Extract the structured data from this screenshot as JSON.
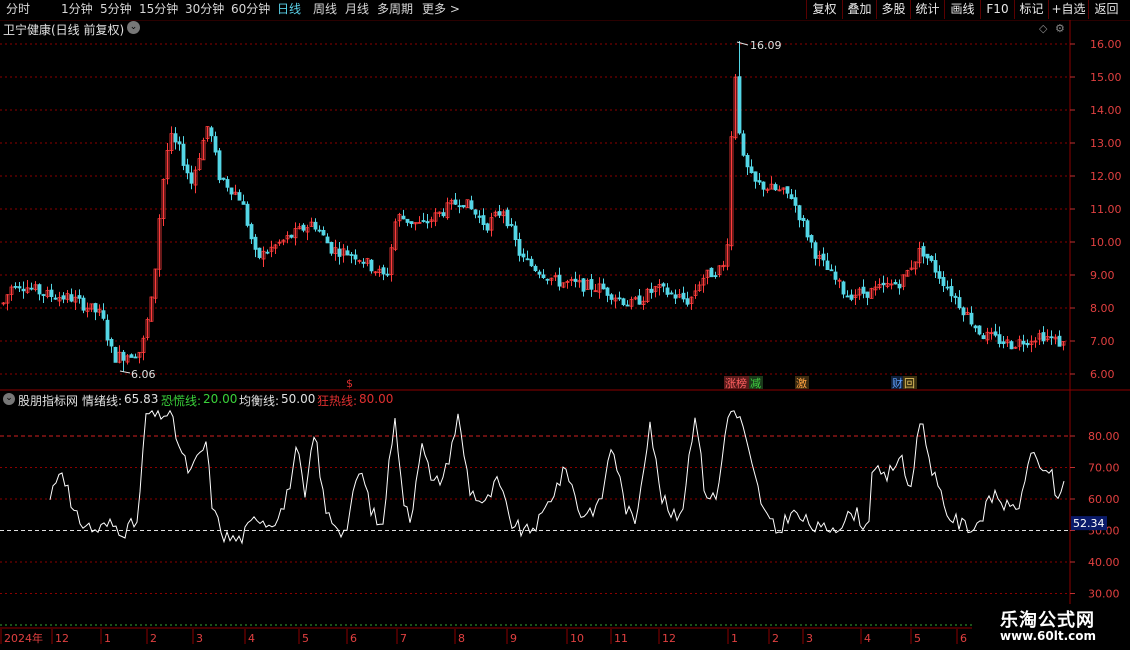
{
  "toolbar": {
    "timeframes": [
      {
        "label": "分时",
        "active": false
      },
      {
        "label": "1分钟",
        "active": false
      },
      {
        "label": "5分钟",
        "active": false
      },
      {
        "label": "15分钟",
        "active": false
      },
      {
        "label": "30分钟",
        "active": false
      },
      {
        "label": "60分钟",
        "active": false
      },
      {
        "label": "日线",
        "active": true
      },
      {
        "label": "周线",
        "active": false
      },
      {
        "label": "月线",
        "active": false
      },
      {
        "label": "多周期",
        "active": false
      },
      {
        "label": "更多",
        "active": false
      }
    ],
    "buttons": [
      "复权",
      "叠加",
      "多股",
      "统计",
      "画线",
      "F10",
      "标记",
      "+自选",
      "返回"
    ]
  },
  "main_chart": {
    "title": "卫宁健康(日线 前复权)",
    "price_axis": [
      "16.00",
      "15.00",
      "14.00",
      "13.00",
      "12.00",
      "11.00",
      "10.00",
      "9.00",
      "8.00",
      "7.00",
      "6.00"
    ],
    "high_label": "16.09",
    "low_label": "6.06",
    "event_marks": {
      "s_mark": "$",
      "zhang_bang": "涨榜",
      "jian": "减",
      "ji": "激",
      "cai": "财",
      "hui": "回"
    }
  },
  "indicator": {
    "name": "股朋指标网",
    "line1_label": "情绪线:",
    "line1_value": "65.83",
    "line2_label": "恐慌线:",
    "line2_value": "20.00",
    "line3_label": "均衡线:",
    "line3_value": "50.00",
    "line4_label": "狂热线:",
    "line4_value": "80.00",
    "axis": [
      "80.00",
      "70.00",
      "60.00",
      "50.00",
      "40.00",
      "30.00"
    ],
    "current_value": "52.34"
  },
  "date_axis": [
    "2024年",
    "12",
    "1",
    "2",
    "3",
    "4",
    "5",
    "6",
    "7",
    "8",
    "9",
    "10",
    "11",
    "12",
    "1",
    "2",
    "3",
    "4",
    "5",
    "6"
  ],
  "watermark": {
    "title": "乐淘公式网",
    "url": "www.60lt.com"
  },
  "colors": {
    "up": "#ff3c3c",
    "down": "#54d6e6",
    "line": "#ffffff",
    "grid": "#8b0000",
    "active": "#5ad1e8"
  },
  "chart_data": [
    {
      "type": "candlestick",
      "title": "卫宁健康(日线 前复权)",
      "ylim": [
        5.8,
        16.6
      ],
      "x": [
        "2024-01",
        "2024-02",
        "2024-03",
        "2024-04",
        "2024-05",
        "2024-06",
        "2024-07",
        "2024-08",
        "2024-09",
        "2024-10",
        "2024-11",
        "2024-12",
        "2025-01",
        "2025-02",
        "2025-03",
        "2025-04",
        "2025-05",
        "2025-06"
      ],
      "close": [
        8.0,
        6.6,
        12.8,
        12.2,
        9.5,
        10.2,
        9.4,
        11.1,
        9.0,
        8.7,
        8.4,
        8.8,
        12.5,
        11.3,
        8.6,
        9.2,
        7.2,
        6.8
      ],
      "max": 16.09,
      "min": 6.06
    },
    {
      "type": "line",
      "title": "股朋指标网",
      "ylim": [
        30,
        88
      ],
      "series": [
        {
          "name": "情绪线",
          "values": [
            60,
            70,
            52,
            52,
            87,
            68,
            52,
            49,
            72,
            52,
            85,
            58,
            84,
            55,
            49,
            63,
            55,
            86,
            52,
            50,
            87,
            55,
            52,
            58,
            85,
            53,
            51,
            55,
            65,
            64
          ]
        }
      ],
      "reference_lines": {
        "恐慌线": 20,
        "均衡线": 50,
        "狂热线": 80
      }
    }
  ]
}
